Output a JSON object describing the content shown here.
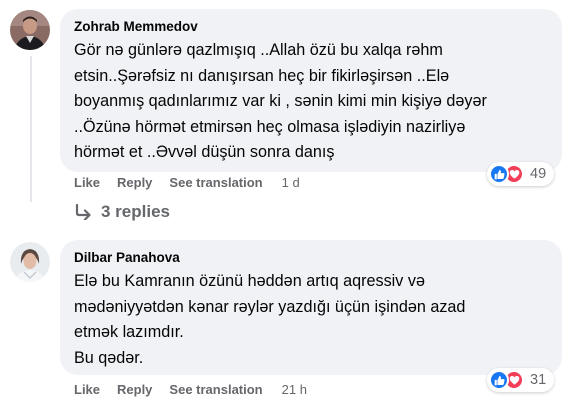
{
  "comments": [
    {
      "author": "Zohrab Memmedov",
      "lines": [
        "Gör nə günlərə qazlmışıq ..Allah özü bu xalqa rəhm",
        "etsin..Şərəfsiz nı danışırsan heç bir fikirləşirsən ..Elə",
        "boyanmış qadınlarımız var ki , sənin kimi min kişiyə dəyər",
        "..Özünə hörmət etmirsən heç olmasa işlədiyin nazirliyə",
        "hörmət et ..Əvvəl düşün sonra danış"
      ],
      "actions": {
        "like": "Like",
        "reply": "Reply",
        "translate": "See translation"
      },
      "time": "1 d",
      "reaction_count": "49",
      "reaction_icons": [
        "like-icon",
        "love-icon"
      ]
    },
    {
      "author": "Dilbar Panahova",
      "lines": [
        "Elə bu Kamranın özünü həddən artıq aqressiv və",
        "mədəniyyətdən kənar rəylər yazdığı üçün işindən azad",
        "etmək lazımdır.",
        "Bu qədər."
      ],
      "actions": {
        "like": "Like",
        "reply": "Reply",
        "translate": "See translation"
      },
      "time": "21 h",
      "reaction_count": "31",
      "reaction_icons": [
        "like-icon",
        "love-icon"
      ]
    }
  ],
  "replies_link": "3 replies",
  "colors": {
    "bubble": "#f0f2f5",
    "secondary_text": "#65676b",
    "like_blue": "#1877f2",
    "love_red": "#f33e58"
  }
}
